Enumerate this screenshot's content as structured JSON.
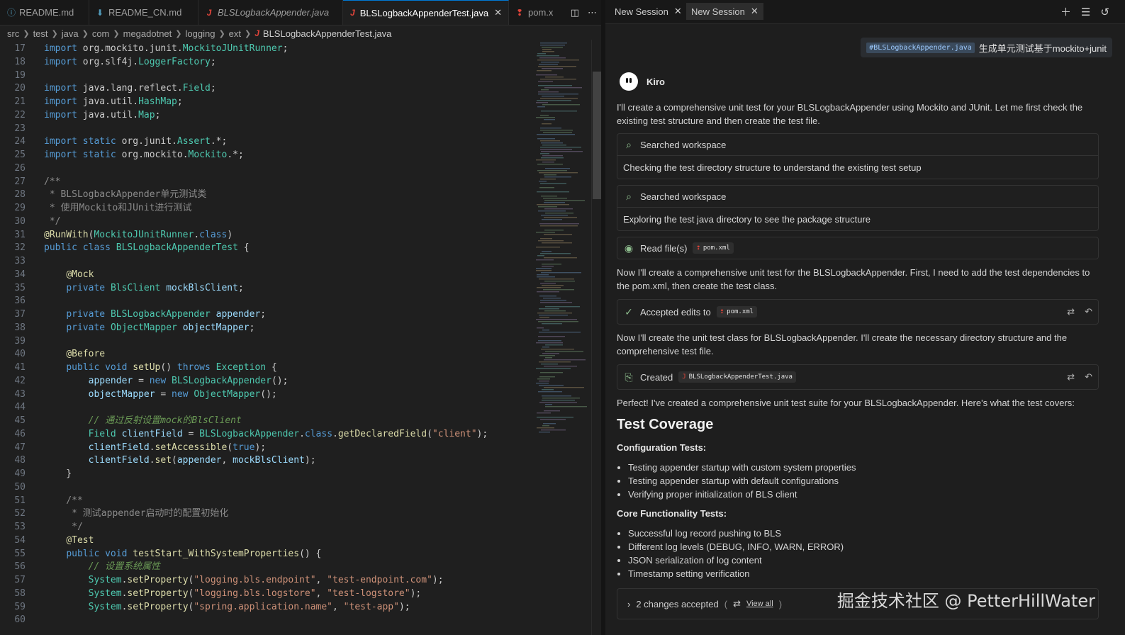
{
  "editor": {
    "tabs": [
      {
        "label": "README.md",
        "icon": "info-icon"
      },
      {
        "label": "README_CN.md",
        "icon": "markdown-icon"
      },
      {
        "label": "BLSLogbackAppender.java",
        "icon": "java-icon"
      },
      {
        "label": "BLSLogbackAppenderTest.java",
        "icon": "java-icon"
      },
      {
        "label": "pom.x",
        "icon": "xml-icon"
      }
    ],
    "breadcrumb": [
      "src",
      "test",
      "java",
      "com",
      "megadotnet",
      "logging",
      "ext",
      "BLSLogbackAppenderTest.java"
    ],
    "lines": [
      {
        "n": "17",
        "text": "import org.mockito.junit.MockitoJUnitRunner;"
      },
      {
        "n": "18",
        "text": "import org.slf4j.LoggerFactory;"
      },
      {
        "n": "19",
        "text": ""
      },
      {
        "n": "20",
        "text": "import java.lang.reflect.Field;"
      },
      {
        "n": "21",
        "text": "import java.util.HashMap;"
      },
      {
        "n": "22",
        "text": "import java.util.Map;"
      },
      {
        "n": "23",
        "text": ""
      },
      {
        "n": "24",
        "text": "import static org.junit.Assert.*;"
      },
      {
        "n": "25",
        "text": "import static org.mockito.Mockito.*;"
      },
      {
        "n": "26",
        "text": ""
      },
      {
        "n": "27",
        "text": "/**"
      },
      {
        "n": "28",
        "text": " * BLSLogbackAppender单元测试类"
      },
      {
        "n": "29",
        "text": " * 使用Mockito和JUnit进行测试"
      },
      {
        "n": "30",
        "text": " */"
      },
      {
        "n": "31",
        "text": "@RunWith(MockitoJUnitRunner.class)"
      },
      {
        "n": "32",
        "text": "public class BLSLogbackAppenderTest {"
      },
      {
        "n": "33",
        "text": ""
      },
      {
        "n": "34",
        "text": "    @Mock"
      },
      {
        "n": "35",
        "text": "    private BlsClient mockBlsClient;"
      },
      {
        "n": "36",
        "text": ""
      },
      {
        "n": "37",
        "text": "    private BLSLogbackAppender appender;"
      },
      {
        "n": "38",
        "text": "    private ObjectMapper objectMapper;"
      },
      {
        "n": "39",
        "text": ""
      },
      {
        "n": "40",
        "text": "    @Before"
      },
      {
        "n": "41",
        "text": "    public void setUp() throws Exception {"
      },
      {
        "n": "42",
        "text": "        appender = new BLSLogbackAppender();"
      },
      {
        "n": "43",
        "text": "        objectMapper = new ObjectMapper();"
      },
      {
        "n": "44",
        "text": ""
      },
      {
        "n": "45",
        "text": "        // 通过反射设置mock的BlsClient"
      },
      {
        "n": "46",
        "text": "        Field clientField = BLSLogbackAppender.class.getDeclaredField(\"client\");"
      },
      {
        "n": "47",
        "text": "        clientField.setAccessible(true);"
      },
      {
        "n": "48",
        "text": "        clientField.set(appender, mockBlsClient);"
      },
      {
        "n": "49",
        "text": "    }"
      },
      {
        "n": "50",
        "text": ""
      },
      {
        "n": "51",
        "text": "    /**"
      },
      {
        "n": "52",
        "text": "     * 测试appender启动时的配置初始化"
      },
      {
        "n": "53",
        "text": "     */"
      },
      {
        "n": "54",
        "text": "    @Test"
      },
      {
        "n": "55",
        "text": "    public void testStart_WithSystemProperties() {"
      },
      {
        "n": "56",
        "text": "        // 设置系统属性"
      },
      {
        "n": "57",
        "text": "        System.setProperty(\"logging.bls.endpoint\", \"test-endpoint.com\");"
      },
      {
        "n": "58",
        "text": "        System.setProperty(\"logging.bls.logstore\", \"test-logstore\");"
      },
      {
        "n": "59",
        "text": "        System.setProperty(\"spring.application.name\", \"test-app\");"
      },
      {
        "n": "60",
        "text": ""
      }
    ]
  },
  "chat": {
    "tabs": [
      {
        "label": "New Session"
      },
      {
        "label": "New Session"
      }
    ],
    "user_message": {
      "context": "#BLSLogbackAppender.java",
      "text": "生成单元测试基于mockito+junit"
    },
    "agent_name": "Kiro",
    "intro": "I'll create a comprehensive unit test for your BLSLogbackAppender using Mockito and JUnit. Let me first check the existing test structure and then create the test file.",
    "steps": {
      "search1": {
        "title": "Searched workspace",
        "detail": "Checking the test directory structure to understand the existing test setup"
      },
      "search2": {
        "title": "Searched workspace",
        "detail": "Exploring the test java directory to see the package structure"
      },
      "read": {
        "title": "Read file(s)",
        "file": "pom.xml"
      },
      "accepted": {
        "title": "Accepted edits to",
        "file": "pom.xml"
      },
      "created": {
        "title": "Created",
        "file": "BLSLogbackAppenderTest.java"
      }
    },
    "para2": "Now I'll create a comprehensive unit test for the BLSLogbackAppender. First, I need to add the test dependencies to the pom.xml, then create the test class.",
    "para3": "Now I'll create the unit test class for BLSLogbackAppender. I'll create the necessary directory structure and the comprehensive test file.",
    "para4": "Perfect! I've created a comprehensive unit test suite for your BLSLogbackAppender. Here's what the test covers:",
    "coverage_heading": "Test Coverage",
    "config_heading": "Configuration Tests:",
    "config_items": [
      "Testing appender startup with custom system properties",
      "Testing appender startup with default configurations",
      "Verifying proper initialization of BLS client"
    ],
    "core_heading": "Core Functionality Tests:",
    "core_items": [
      "Successful log record pushing to BLS",
      "Different log levels (DEBUG, INFO, WARN, ERROR)",
      "JSON serialization of log content",
      "Timestamp setting verification"
    ],
    "changes": {
      "count_label": "2 changes accepted",
      "view_all": "View all"
    },
    "watermark": "掘金技术社区 @ PetterHillWater"
  }
}
